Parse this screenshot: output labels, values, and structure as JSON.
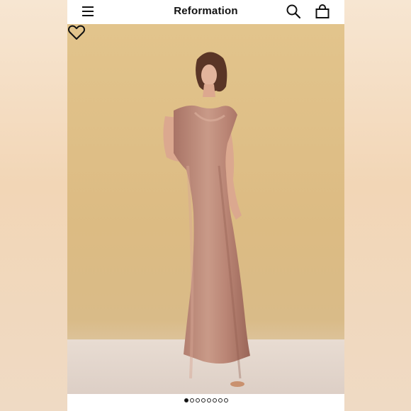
{
  "header": {
    "brand": "Reformation",
    "icons": [
      "menu-icon",
      "search-icon",
      "bag-icon"
    ]
  },
  "product_gallery": {
    "favorite_icon": "heart-icon",
    "image_count": 8,
    "active_image_index": 1
  },
  "colors": {
    "background": "#e2c48c",
    "dress": "#b98474",
    "header": "#ffffff"
  }
}
